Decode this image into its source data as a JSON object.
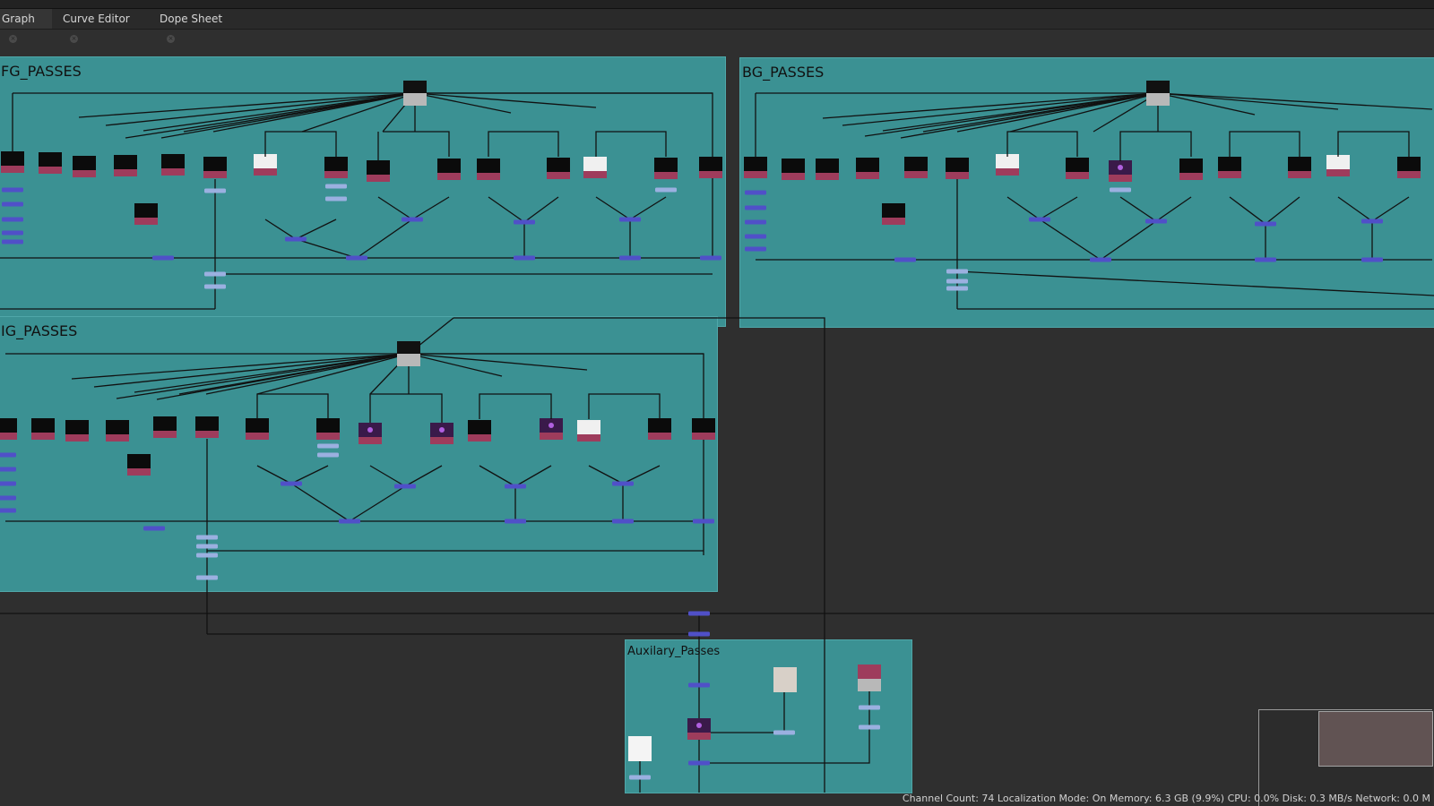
{
  "tabs": [
    {
      "label": "Graph",
      "active": true
    },
    {
      "label": "Curve Editor",
      "active": false
    },
    {
      "label": "Dope Sheet",
      "active": false
    }
  ],
  "close_glyph": "×",
  "backdrops": {
    "fg": "FG_PASSES",
    "bg": "BG_PASSES",
    "mg": "IG_PASSES",
    "aux": "Auxilary_Passes"
  },
  "status_bar": "Channel Count: 74  Localization Mode: On  Memory: 6.3 GB (9.9%)  CPU: 0.0%  Disk: 0.3 MB/s  Network: 0.0 M",
  "colors": {
    "backdrop": "#3b9193",
    "background": "#2f2f2f",
    "read_node_label": "#9e3c5c",
    "dot_node": "#5050c8",
    "merge_node_light": "#9bb0e0"
  },
  "icons": {
    "tab_close": "close-icon",
    "node": "read-node-icon",
    "merge": "merge-node-icon"
  }
}
